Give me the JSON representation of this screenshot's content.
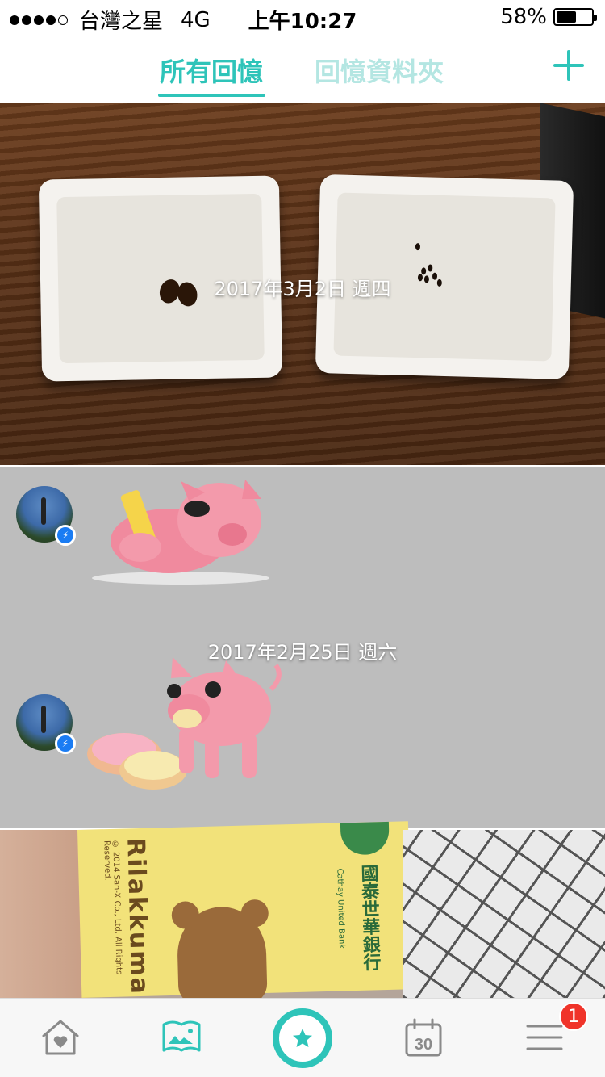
{
  "status_bar": {
    "carrier": "台灣之星",
    "network": "4G",
    "time": "上午10:27",
    "battery": "58%",
    "battery_level": 0.58
  },
  "nav": {
    "tab_all": "所有回憶",
    "tab_folder": "回憶資料夾"
  },
  "feed": {
    "card1_date": "2017年3月2日 週四",
    "card2_date": "2017年2月25日 週六",
    "card3_brand": "Rilakkuma",
    "card3_copyright": "© 2014 San-X Co., Ltd. All Rights Reserved.",
    "card3_bank": "國泰世華銀行",
    "card3_bank_en": "Cathay United Bank"
  },
  "tab_bar": {
    "calendar_day": "30",
    "menu_badge": "1"
  }
}
